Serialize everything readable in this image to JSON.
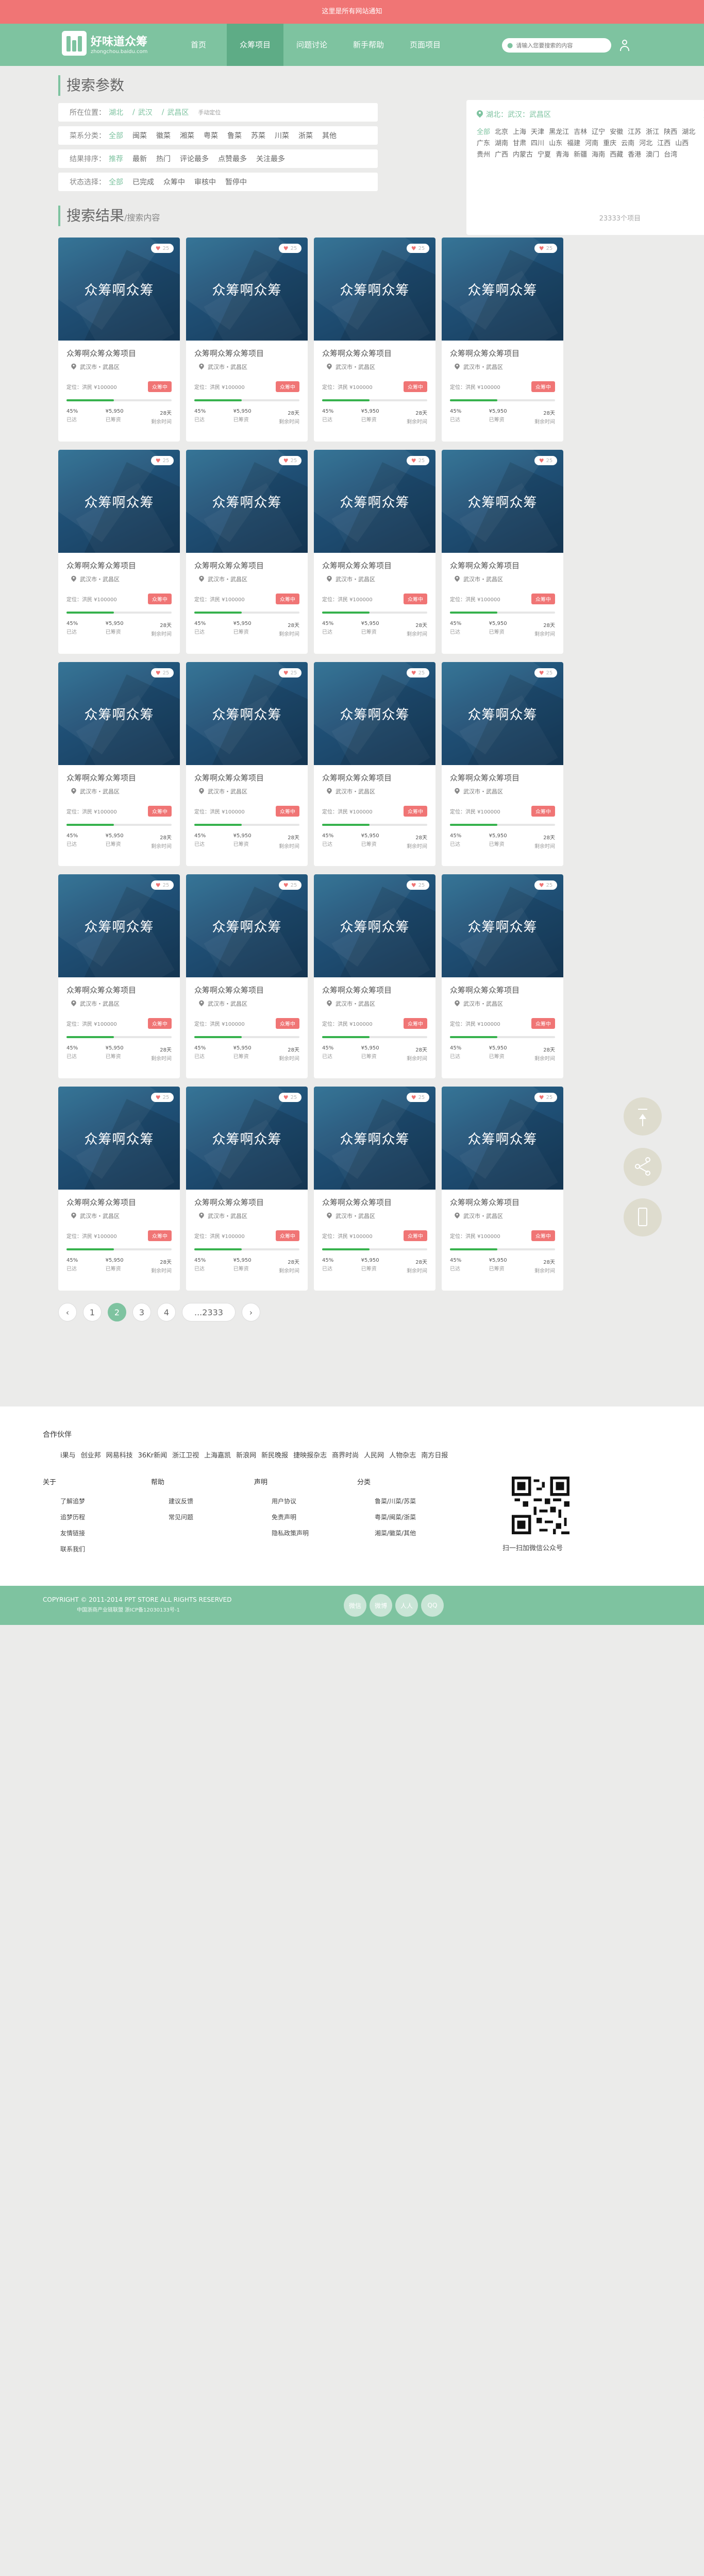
{
  "topbar": {
    "text": "这里是所有网站通知"
  },
  "brand": {
    "name": "好味道众筹",
    "domain": "zhongchou.baidu.com"
  },
  "nav": {
    "items": [
      "首页",
      "众筹项目",
      "问题讨论",
      "新手帮助",
      "页面项目"
    ],
    "active_index": 1
  },
  "search": {
    "placeholder": "请输入您要搜索的内容"
  },
  "filters": {
    "title": "搜索参数",
    "location": {
      "label": "所在位置：",
      "values": [
        "湖北",
        "武汉",
        "武昌区"
      ],
      "extra": "手动定位"
    },
    "category": {
      "label": "菜系分类：",
      "options": [
        "全部",
        "闽菜",
        "徽菜",
        "湘菜",
        "粤菜",
        "鲁菜",
        "苏菜",
        "川菜",
        "浙菜",
        "其他"
      ]
    },
    "sort": {
      "label": "结果排序：",
      "options": [
        "推荐",
        "最新",
        "热门",
        "评论最多",
        "点赞最多",
        "关注最多"
      ]
    },
    "status": {
      "label": "状态选择：",
      "options": [
        "全部",
        "已完成",
        "众筹中",
        "审核中",
        "暂停中"
      ]
    }
  },
  "region_popup": {
    "crumb": "湖北：武汉：武昌区",
    "provinces": [
      "全部",
      "北京",
      "上海",
      "天津",
      "黑龙江",
      "吉林",
      "辽宁",
      "安徽",
      "江苏",
      "浙江",
      "陕西",
      "湖北",
      "广东",
      "湖南",
      "甘肃",
      "四川",
      "山东",
      "福建",
      "河南",
      "重庆",
      "云南",
      "河北",
      "江西",
      "山西",
      "贵州",
      "广西",
      "内蒙古",
      "宁夏",
      "青海",
      "新疆",
      "海南",
      "西藏",
      "香港",
      "澳门",
      "台湾"
    ]
  },
  "results": {
    "title": "搜索结果",
    "subtitle": "/搜索内容",
    "count": "23333个项目"
  },
  "card": {
    "image_text": "众筹啊众筹",
    "likes": "25",
    "title": "众筹啊众筹众筹项目",
    "location": "武汉市・武昌区",
    "founder": "定位：洪民  ¥100000",
    "badge": "众筹中",
    "progress": 0.45,
    "stats": [
      {
        "v": "45%",
        "k": "已达"
      },
      {
        "v": "¥5,950",
        "k": "已筹资"
      },
      {
        "v": "28天",
        "k": "剩余时间"
      }
    ]
  },
  "pager": {
    "prev": "‹",
    "pages": [
      "1",
      "2",
      "3",
      "4",
      "...2333"
    ],
    "current": "2",
    "next": "›"
  },
  "footer": {
    "partners_title": "合作伙伴",
    "partners": [
      "i果与",
      "创业邦",
      "网易科技",
      "36Kr新闻",
      "浙江卫视",
      "上海嘉凯",
      "新浪网",
      "新民晚报",
      "捷映报杂志",
      "商界时尚",
      "人民网",
      "人物杂志",
      "南方日报"
    ],
    "columns": [
      {
        "h": "关于",
        "items": [
          "了解追梦",
          "追梦历程",
          "友情链接",
          "联系我们"
        ]
      },
      {
        "h": "帮助",
        "items": [
          "建议反馈",
          "常见问题"
        ]
      },
      {
        "h": "声明",
        "items": [
          "用户协议",
          "免责声明",
          "隐私政策声明"
        ]
      },
      {
        "h": "分类",
        "items": [
          "鲁菜/川菜/苏菜",
          "粤菜/闽菜/浙菜",
          "湘菜/徽菜/其他"
        ]
      }
    ],
    "qr_caption": "扫一扫加微信公众号"
  },
  "bottom": {
    "copyright": "COPYRIGHT © 2011-2014 PPT STORE ALL RIGHTS RESERVED",
    "icp": "中国浙商产业链联盟   浙ICP备12030133号-1",
    "social": [
      "微信",
      "微博",
      "人人",
      "QQ"
    ]
  },
  "colors": {
    "brand_green": "#7ec3a0",
    "alert_red": "#f07575",
    "progress_green": "#37b24d"
  }
}
